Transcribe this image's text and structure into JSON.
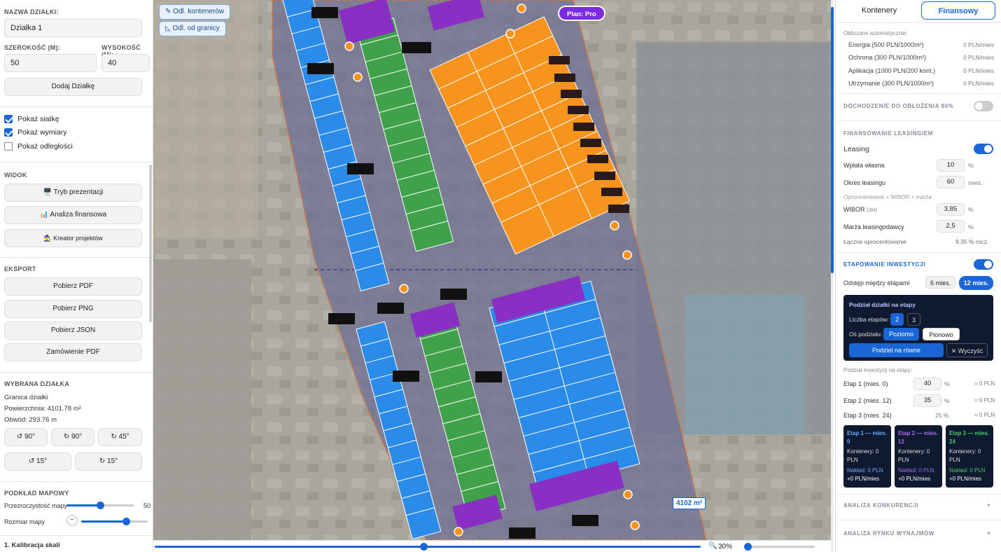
{
  "left": {
    "plot_name_label": "NAZWA DZIAŁKI:",
    "plot_name_value": "Działka 1",
    "width_label": "SZEROKOŚĆ (M):",
    "height_label": "WYSOKOŚĆ (M):",
    "width_value": "50",
    "height_value": "40",
    "add_plot": "Dodaj Działkę",
    "show_grid": "Pokaż siatkę",
    "show_dims": "Pokaż wymiary",
    "show_dist": "Pokaż odległości",
    "view_header": "WIDOK",
    "presentation_mode": "🖥️ Tryb prezentacji",
    "financial_analysis": "📊 Analiza finansowa",
    "project_wizard": "🧙 Kreator projektów",
    "export_header": "EKSPORT",
    "download_pdf": "Pobierz PDF",
    "download_png": "Pobierz PNG",
    "download_json": "Pobierz JSON",
    "order_pdf": "Zamówienie PDF",
    "selected_header": "WYBRANA DZIAŁKA",
    "boundary": "Granica działki",
    "area": "Powierzchnia: 4101.78 m²",
    "perimeter": "Obwód: 293.76 m",
    "rot_ccw90": "↺ 90°",
    "rot_cw90": "↻ 90°",
    "rot_cw45": "↻ 45°",
    "rot_ccw15": "↺ 15°",
    "rot_cw15": "↻ 15°",
    "basemap_header": "PODKŁAD MAPOWY",
    "map_opacity": "Przezroczystość mapy",
    "map_opacity_value": "50",
    "map_size": "Rozmiar mapy",
    "calibration": "1. Kalibracja skali"
  },
  "map": {
    "btn_container_dist": "Odl. kontenerów",
    "btn_border_dist": "Odl. od granicy",
    "plan_badge": "Plan: Pro",
    "area_label": "4102 m²",
    "zoom": "30%"
  },
  "right": {
    "tab_containers": "Kontenery",
    "tab_financial": "Finansowy",
    "auto_calc": "Obliczane automatycznie:",
    "costs": [
      {
        "label": "Energia (500 PLN/1000m²)",
        "value": "0 PLN/mies"
      },
      {
        "label": "Ochrona (300 PLN/1000m²)",
        "value": "0 PLN/mies"
      },
      {
        "label": "Aplikacja (1000 PLN/200 kont.)",
        "value": "0 PLN/mies"
      },
      {
        "label": "Utrzymanie (300 PLN/1000m²)",
        "value": "0 PLN/mies"
      }
    ],
    "occupancy_header": "DOCHODZENIE DO OBŁOŻENIA 80%",
    "leasing_header": "FINANSOWANIE LEASINGIEM",
    "leasing": "Leasing",
    "down_payment": "Wpłata własna",
    "down_payment_value": "10",
    "down_payment_unit": "%",
    "lease_period": "Okres leasingu",
    "lease_period_value": "60",
    "lease_period_unit": "mies.",
    "interest_note": "Oprocentowanie = WIBOR + marża",
    "wibor": "WIBOR",
    "wibor_sub": "(3M)",
    "wibor_value": "3,85",
    "margin": "Marża leasingodawcy",
    "margin_value": "2,5",
    "pct": "%",
    "total_interest": "Łączne oprocentowanie",
    "total_interest_value": "9.35 % rocz.",
    "staging_header": "ETAPOWANIE INWESTYCJI",
    "stage_gap": "Odstęp między etapami",
    "gap_6": "6 mies.",
    "gap_12": "12 mies.",
    "split_title": "Podział działki na etapy",
    "stage_count": "Liczba etapów:",
    "count_2": "2",
    "count_3": "3",
    "axis": "Oś podziału:",
    "axis_h": "Poziomo",
    "axis_v": "Pionowo",
    "split_equal": "Podziel na równe",
    "clear": "✕ Wyczyść",
    "invest_split": "Podział inwestycji na etapy:",
    "stages": [
      {
        "label": "Etap 1 (mies. 0)",
        "value": "40",
        "unit": "%",
        "result": "= 0 PLN"
      },
      {
        "label": "Etap 2 (mies. 12)",
        "value": "35",
        "unit": "%",
        "result": "= 0 PLN"
      },
      {
        "label": "Etap 3 (mies. 24)",
        "value": "25 %",
        "result": "= 0 PLN"
      }
    ],
    "cards": [
      {
        "title": "Etap 1 — mies. 0",
        "containers": "Kontenery: 0",
        "pln": "PLN",
        "cost": "Nakład: 0 PLN",
        "income": "+0 PLN/mies",
        "color": "#6fa8ff"
      },
      {
        "title": "Etap 2 — mies. 12",
        "containers": "Kontenery: 0",
        "pln": "PLN",
        "cost": "Nakład: 0 PLN",
        "income": "+0 PLN/mies",
        "color": "#a46cf0"
      },
      {
        "title": "Etap 3 — mies. 24",
        "containers": "Kontenery: 0",
        "pln": "PLN",
        "cost": "Nakład: 0 PLN",
        "income": "+0 PLN/mies",
        "color": "#48c76a"
      }
    ],
    "competition": "ANALIZA KONKURENCJI",
    "rental_market": "ANALIZA RYNKU WYNAJMÓW"
  }
}
